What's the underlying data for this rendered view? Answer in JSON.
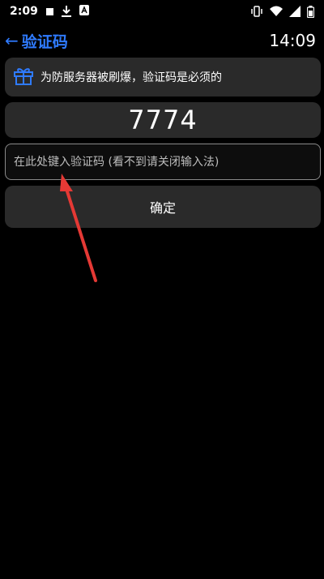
{
  "status_bar": {
    "time": "2:09",
    "icons": [
      "notification-square-icon",
      "download-icon",
      "app-a-icon",
      "vibrate-icon",
      "wifi-icon",
      "signal-icon",
      "battery-icon"
    ]
  },
  "header": {
    "back_icon": "arrow-left-icon",
    "title": "验证码",
    "clock": "14:09"
  },
  "notice": {
    "icon": "gift-icon",
    "text": "为防服务器被刷爆，验证码是必须的"
  },
  "captcha": {
    "code": "7774"
  },
  "input": {
    "value": "",
    "placeholder": "在此处键入验证码 (看不到请关闭输入法)"
  },
  "confirm_button": {
    "label": "确定"
  },
  "colors": {
    "accent": "#2f7bff",
    "card": "#2a2a2a",
    "background": "#000000",
    "annotation_arrow": "#e53935"
  }
}
